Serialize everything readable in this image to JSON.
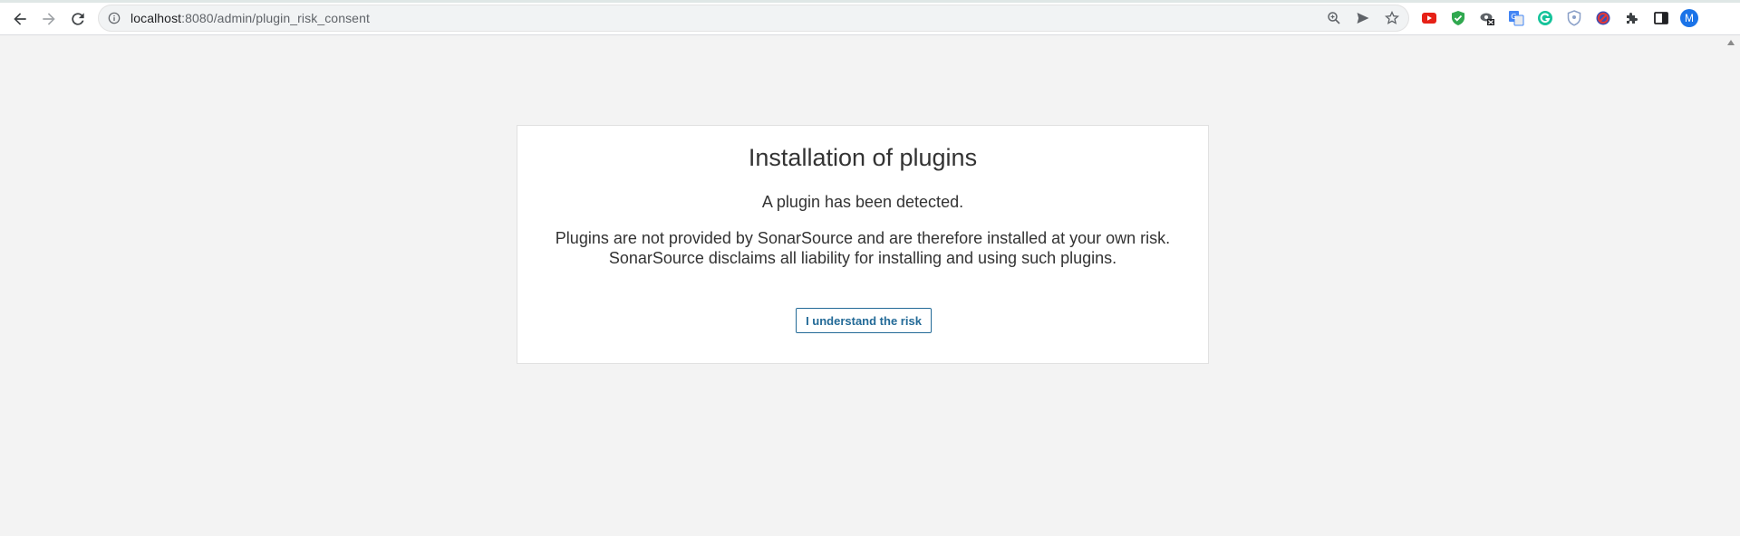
{
  "browser": {
    "url_host": "localhost",
    "url_path": ":8080/admin/plugin_risk_consent",
    "nav": {
      "back": "back-arrow-icon",
      "forward": "forward-arrow-icon",
      "reload": "reload-icon"
    },
    "omnibox_icons": [
      "zoom-icon",
      "send-icon",
      "bookmark-star-icon"
    ],
    "extensions": [
      "youtube-ext-icon",
      "shield-check-ext-icon",
      "eye-ext-icon",
      "translate-ext-icon",
      "grammarly-ext-icon",
      "privacy-shield-ext-icon",
      "blocked-ext-icon",
      "puzzle-icon",
      "side-panel-icon"
    ],
    "profile_initial": "M"
  },
  "modal": {
    "title": "Installation of plugins",
    "detected": "A plugin has been detected.",
    "disclaimer_line1": "Plugins are not provided by SonarSource and are therefore installed at your own risk.",
    "disclaimer_line2": "SonarSource disclaims all liability for installing and using such plugins.",
    "button_label": "I understand the risk"
  },
  "colors": {
    "page_bg": "#f3f3f3",
    "button_accent": "#236a97",
    "text": "#333333"
  }
}
